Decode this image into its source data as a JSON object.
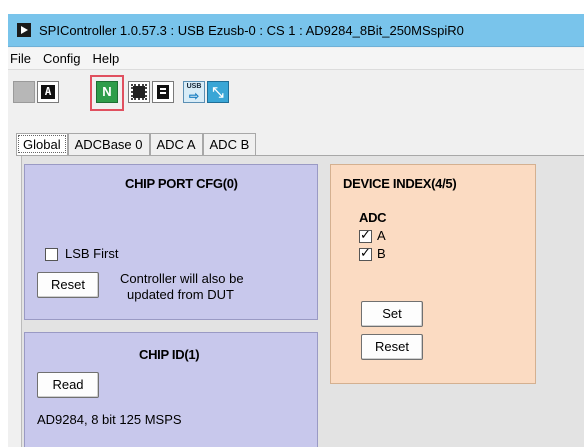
{
  "window": {
    "title": "SPIController 1.0.57.3 : USB Ezusb-0 : CS 1 : AD9284_8Bit_250MSspiR0"
  },
  "menu": [
    "File",
    "Config",
    "Help"
  ],
  "toolbar": {
    "chip_a_label": "A",
    "n_label": "N",
    "usb_label": "USB"
  },
  "tabs": [
    "Global",
    "ADCBase 0",
    "ADC A",
    "ADC B"
  ],
  "chip_port_cfg": {
    "title": "CHIP PORT CFG(0)",
    "lsb_first_label": "LSB First",
    "lsb_first_checked": false,
    "reset_label": "Reset",
    "note_line1": "Controller will also be",
    "note_line2": "updated from DUT"
  },
  "device_index": {
    "title": "DEVICE INDEX(4/5)",
    "adc_label": "ADC",
    "channels": [
      {
        "label": "A",
        "checked": true
      },
      {
        "label": "B",
        "checked": true
      }
    ],
    "set_label": "Set",
    "reset_label": "Reset"
  },
  "chip_id": {
    "title": "CHIP ID(1)",
    "read_label": "Read",
    "value": "AD9284, 8 bit 125 MSPS"
  }
}
